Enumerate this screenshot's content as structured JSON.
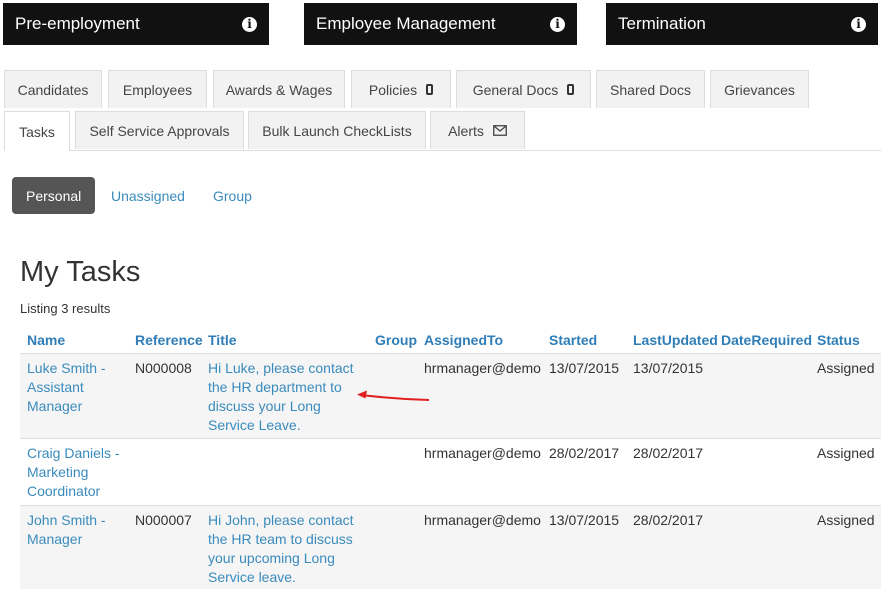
{
  "modules": [
    {
      "label": "Pre-employment"
    },
    {
      "label": "Employee Management"
    },
    {
      "label": "Termination"
    }
  ],
  "tabs_row1": [
    {
      "label": "Candidates"
    },
    {
      "label": "Employees"
    },
    {
      "label": "Awards & Wages"
    },
    {
      "label": "Policies",
      "icon": "mobile-icon"
    },
    {
      "label": "General Docs",
      "icon": "mobile-icon"
    },
    {
      "label": "Shared Docs"
    },
    {
      "label": "Grievances"
    }
  ],
  "tabs_row2": [
    {
      "label": "Tasks",
      "active": true
    },
    {
      "label": "Self Service Approvals"
    },
    {
      "label": "Bulk Launch CheckLists"
    },
    {
      "label": "Alerts",
      "icon": "envelope-icon"
    }
  ],
  "pills": [
    {
      "label": "Personal",
      "active": true
    },
    {
      "label": "Unassigned"
    },
    {
      "label": "Group"
    }
  ],
  "page": {
    "title": "My Tasks",
    "listing": "Listing 3 results"
  },
  "table": {
    "columns": [
      "Name",
      "Reference",
      "Title",
      "Group",
      "AssignedTo",
      "Started",
      "LastUpdated",
      "DateRequired",
      "Status"
    ],
    "rows": [
      {
        "name": [
          "Luke Smith -",
          "Assistant",
          "Manager"
        ],
        "reference": "N000008",
        "title": [
          "Hi Luke, please contact",
          "the HR department to",
          "discuss your Long",
          "Service Leave."
        ],
        "group": "",
        "assigned_to": "hrmanager@demo",
        "started": "13/07/2015",
        "last_updated": "13/07/2015",
        "date_required": "",
        "status": "Assigned"
      },
      {
        "name": [
          "Craig Daniels -",
          "Marketing",
          "Coordinator"
        ],
        "reference": "",
        "title": [],
        "group": "",
        "assigned_to": "hrmanager@demo",
        "started": "28/02/2017",
        "last_updated": "28/02/2017",
        "date_required": "",
        "status": "Assigned"
      },
      {
        "name": [
          "John Smith -",
          "Manager"
        ],
        "reference": "N000007",
        "title": [
          "Hi John, please contact",
          "the HR team to discuss",
          "your upcoming Long",
          "Service leave."
        ],
        "group": "",
        "assigned_to": "hrmanager@demo",
        "started": "13/07/2015",
        "last_updated": "28/02/2017",
        "date_required": "",
        "status": "Assigned"
      }
    ]
  },
  "colors": {
    "module_bg": "#111111",
    "link": "#3a8bbd",
    "header_link": "#2f7eb8",
    "active_pill": "#555555",
    "arrow": "#e02020"
  }
}
